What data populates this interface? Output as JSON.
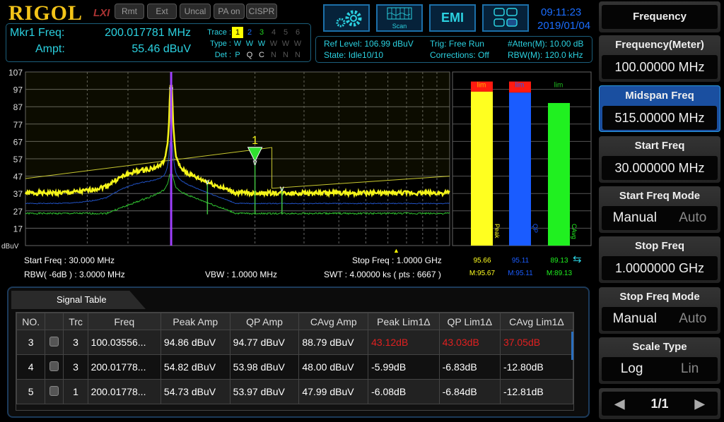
{
  "header": {
    "logo": "RIGOL",
    "lxi": "LXI",
    "status": [
      "Rmt",
      "Ext",
      "Uncal",
      "PA on",
      "CISPR"
    ],
    "scan_label": "Scan",
    "emi_label": "EMI",
    "time": "09:11:23",
    "date": "2019/01/04"
  },
  "marker": {
    "freq_label": "Mkr1 Freq:",
    "freq_value": "200.017781 MHz",
    "ampt_label": "Ampt:",
    "ampt_value": "55.46 dBuV"
  },
  "traces": {
    "trace_label": "Trace :",
    "type_label": "Type :",
    "det_label": "Det :",
    "numbers": [
      "1",
      "2",
      "3",
      "4",
      "5",
      "6"
    ],
    "types": [
      "W",
      "W",
      "W",
      "W",
      "W",
      "W"
    ],
    "dets": [
      "P",
      "Q",
      "C",
      "N",
      "N",
      "N"
    ]
  },
  "settings": {
    "ref_level": "Ref Level: 106.99 dBuV",
    "state": "State: Idle10/10",
    "trig": "Trig: Free Run",
    "corrections": "Corrections: Off",
    "atten": "#Atten(M): 10.00 dB",
    "rbw": "RBW(M): 120.0 kHz"
  },
  "plot": {
    "y_ticks": [
      "107",
      "97",
      "87",
      "77",
      "67",
      "57",
      "47",
      "37",
      "27",
      "17"
    ],
    "y_unit": "dBuV",
    "ylim": [
      7,
      107
    ],
    "x_range_mhz": [
      30,
      1000
    ],
    "x_scale": "log",
    "marker_label": "1",
    "marker_freq_mhz": 200.017781,
    "marker_amp": 55.46,
    "cursor_freq_mhz": 100.03556,
    "limit_line": [
      [
        30,
        45.6
      ],
      [
        230,
        63.5
      ],
      [
        230,
        40
      ],
      [
        1000,
        47
      ]
    ],
    "trace_colors": {
      "peak": "#f5f51a",
      "qp": "#2050c0",
      "cavg": "#30c030",
      "limit": "#c8c830",
      "cursor": "#a040ff"
    }
  },
  "meters": {
    "lim_label": "lim",
    "bars": [
      {
        "name": "Peak",
        "value": "95.66",
        "max": "M:95.67",
        "v": 95.66,
        "color": "#ffff20"
      },
      {
        "name": "QP",
        "value": "95.11",
        "max": "M:95.11",
        "v": 95.11,
        "color": "#1a5cff"
      },
      {
        "name": "CAvg",
        "value": "89.13",
        "max": "M:89.13",
        "v": 89.13,
        "color": "#20f020"
      }
    ]
  },
  "footer": {
    "start": "Start Freq : 30.000 MHz",
    "stop": "Stop Freq : 1.0000 GHz",
    "rbw": "RBW( -6dB ) : 3.0000 MHz",
    "vbw": "VBW : 1.0000 MHz",
    "swt": "SWT : 4.00000 ks ( pts : 6667 )"
  },
  "signal_table": {
    "tab": "Signal Table",
    "headers": [
      "NO.",
      "",
      "Trc",
      "Freq",
      "Peak Amp",
      "QP Amp",
      "CAvg Amp",
      "Peak Lim1Δ",
      "QP Lim1Δ",
      "CAvg Lim1Δ"
    ],
    "rows": [
      [
        "3",
        "",
        "3",
        "100.03556...",
        "94.86 dBuV",
        "94.77 dBuV",
        "88.79 dBuV",
        "43.12dB",
        "43.03dB",
        "37.05dB"
      ],
      [
        "4",
        "",
        "3",
        "200.01778...",
        "54.82 dBuV",
        "53.98 dBuV",
        "48.00 dBuV",
        "-5.99dB",
        "-6.83dB",
        "-12.80dB"
      ],
      [
        "5",
        "",
        "1",
        "200.01778...",
        "54.73 dBuV",
        "53.97 dBuV",
        "47.99 dBuV",
        "-6.08dB",
        "-6.84dB",
        "-12.81dB"
      ]
    ]
  },
  "softkeys": {
    "title": "Frequency",
    "items": [
      {
        "label": "Frequency(Meter)",
        "value": "100.00000 MHz"
      },
      {
        "label": "Midspan Freq",
        "value": "515.00000 MHz"
      },
      {
        "label": "Start Freq",
        "value": "30.000000 MHz"
      },
      {
        "label": "Start Freq Mode",
        "on": "Manual",
        "off": "Auto"
      },
      {
        "label": "Stop Freq",
        "value": "1.0000000 GHz"
      },
      {
        "label": "Stop Freq Mode",
        "on": "Manual",
        "off": "Auto"
      },
      {
        "label": "Scale Type",
        "on": "Log",
        "off": "Lin"
      }
    ],
    "page": "1/1"
  }
}
